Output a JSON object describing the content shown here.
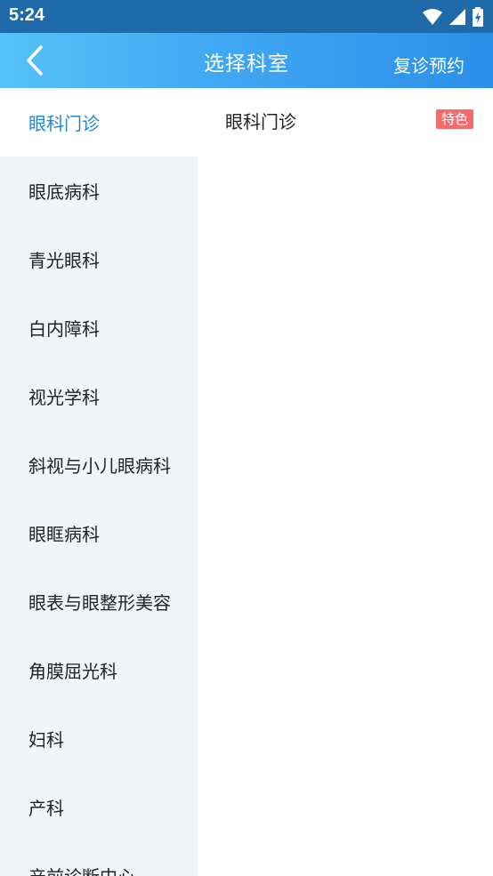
{
  "status_bar": {
    "time": "5:24",
    "icons": [
      "wifi-icon",
      "signal-icon",
      "battery-icon"
    ]
  },
  "header": {
    "title": "选择科室",
    "action_label": "复诊预约",
    "back_icon": "chevron-left-icon"
  },
  "sidebar": {
    "items": [
      {
        "label": "眼科门诊",
        "active": true
      },
      {
        "label": "眼底病科"
      },
      {
        "label": "青光眼科"
      },
      {
        "label": "白内障科"
      },
      {
        "label": "视光学科"
      },
      {
        "label": "斜视与小儿眼病科"
      },
      {
        "label": "眼眶病科"
      },
      {
        "label": "眼表与眼整形美容"
      },
      {
        "label": "角膜屈光科"
      },
      {
        "label": "妇科"
      },
      {
        "label": "产科"
      },
      {
        "label": "产前诊断中心"
      }
    ]
  },
  "content": {
    "departments": [
      {
        "name": "眼科门诊",
        "badge": "特色"
      }
    ]
  },
  "colors": {
    "status_bar": "#1f6aa8",
    "header_start": "#55c2f8",
    "header_end": "#2b8fe8",
    "active_text": "#1f86d8",
    "sidebar_bg": "#f1f5f8",
    "badge_bg": "#f26c6c"
  }
}
